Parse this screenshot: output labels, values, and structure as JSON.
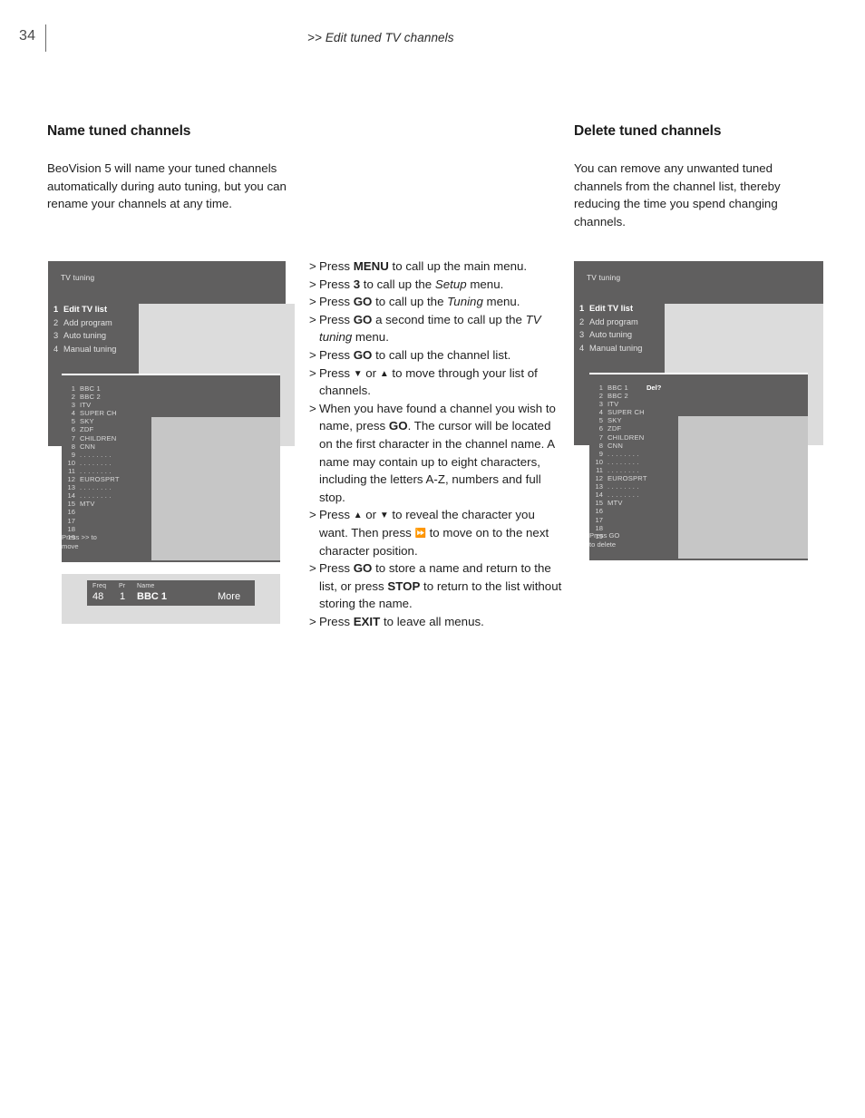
{
  "page": {
    "number": "34",
    "section_header": ">> Edit tuned TV channels"
  },
  "left_column": {
    "heading": "Name tuned channels",
    "body": "BeoVision 5 will name your tuned channels automatically during auto tuning, but you can rename your channels at any time."
  },
  "right_column": {
    "heading": "Delete tuned channels",
    "body": "You can remove any unwanted tuned channels from the channel list, thereby reducing the time you spend changing channels."
  },
  "steps": {
    "marker": ">",
    "items": [
      {
        "id": "step-menu",
        "html": "Press <b>MENU</b> to call up the main menu."
      },
      {
        "id": "step-setup",
        "html": "Press <b>3</b> to call up the <i>Setup</i> menu."
      },
      {
        "id": "step-tuning",
        "html": "Press <b>GO</b> to call up the <i>Tuning</i> menu."
      },
      {
        "id": "step-tvtuning",
        "html": "Press <b>GO</b> a second time to call up the <i>TV tuning</i> menu."
      },
      {
        "id": "step-channellist",
        "html": "Press <b>GO</b> to call up the channel list."
      },
      {
        "id": "step-move",
        "html": "Press <span class=\"glyph\">▼</span> or <span class=\"glyph\">▲</span> to move through your list of channels."
      },
      {
        "id": "step-name",
        "html": "When you have found a channel you wish to name, press <b>GO</b>. The cursor will be located on the first character in the channel name. A name may contain up to eight characters, including the letters A-Z, numbers and full stop."
      },
      {
        "id": "step-character",
        "html": "Press <span class=\"glyph\">▲</span> or <span class=\"glyph\">▼</span> to reveal the character you want. Then press <span class=\"glyph\">⏩</span> to move on to the next character position."
      },
      {
        "id": "step-store",
        "html": "Press <b>GO</b> to store a name and return to the list, or press <b>STOP</b> to return to the list without storing the name."
      },
      {
        "id": "step-exit",
        "html": "Press <b>EXIT</b> to leave all menus."
      }
    ]
  },
  "tv_menu": {
    "title": "TV tuning",
    "items": [
      {
        "num": "1",
        "label": "Edit TV list",
        "selected": true
      },
      {
        "num": "2",
        "label": "Add program",
        "selected": false
      },
      {
        "num": "3",
        "label": "Auto tuning",
        "selected": false
      },
      {
        "num": "4",
        "label": "Manual tuning",
        "selected": false
      }
    ]
  },
  "channel_list": {
    "rows": [
      {
        "num": "1",
        "name": "BBC 1"
      },
      {
        "num": "2",
        "name": "BBC 2"
      },
      {
        "num": "3",
        "name": "ITV"
      },
      {
        "num": "4",
        "name": "SUPER CH"
      },
      {
        "num": "5",
        "name": "SKY"
      },
      {
        "num": "6",
        "name": "ZDF"
      },
      {
        "num": "7",
        "name": "CHILDREN"
      },
      {
        "num": "8",
        "name": "CNN"
      },
      {
        "num": "9",
        "name": ". . . . . . . ."
      },
      {
        "num": "10",
        "name": ". . . . . . . ."
      },
      {
        "num": "11",
        "name": ". . . . . . . ."
      },
      {
        "num": "12",
        "name": "EUROSPRT"
      },
      {
        "num": "13",
        "name": ". . . . . . . ."
      },
      {
        "num": "14",
        "name": ". . . . . . . ."
      },
      {
        "num": "15",
        "name": "MTV"
      },
      {
        "num": "16",
        "name": ""
      },
      {
        "num": "17",
        "name": ""
      },
      {
        "num": "18",
        "name": ""
      },
      {
        "num": "19",
        "name": ""
      }
    ],
    "name_footer_line1": "Press >> to",
    "name_footer_line2": "move",
    "delete_footer_line1": "Press GO",
    "delete_footer_line2": "to delete",
    "delete_flag": "Del?"
  },
  "freq_bar": {
    "label_freq": "Freq",
    "label_pr": "Pr",
    "label_name": "Name",
    "value_freq": "48",
    "value_pr": "1",
    "value_name": "BBC 1",
    "more_label": "More"
  },
  "colors": {
    "screen_dark": "#605f5f",
    "screen_light": "#dcdcdc",
    "screen_light_low": "#c6c6c6",
    "text_body": "#1f1f1f"
  }
}
